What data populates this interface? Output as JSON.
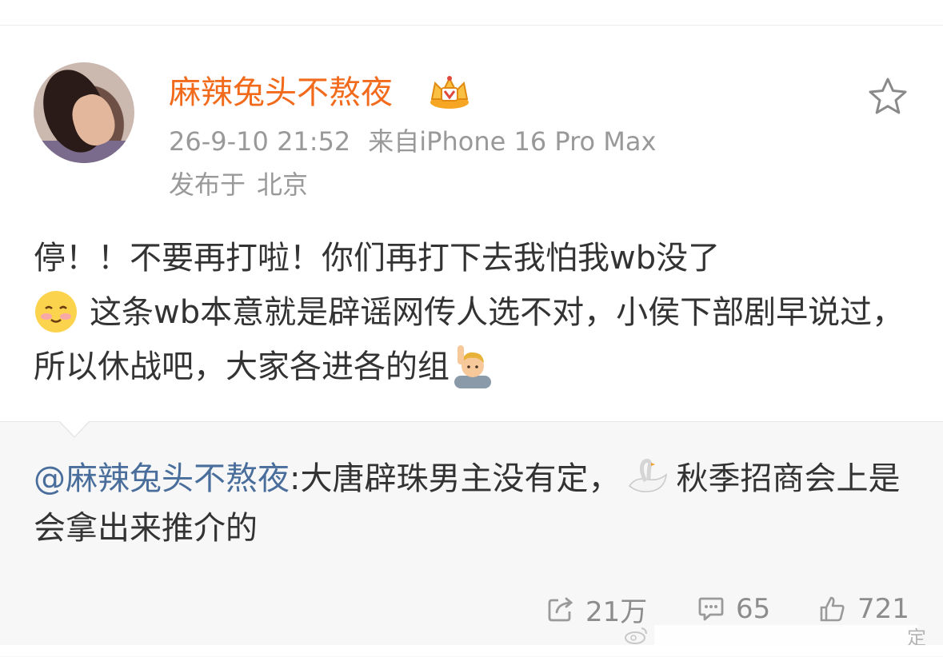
{
  "post": {
    "author": {
      "name": "麻辣兔头不熬夜",
      "badge_icon": "crown-vip-icon",
      "name_color": "#f26b1d"
    },
    "timestamp": "26-9-10 21:52",
    "source": "来自iPhone 16 Pro Max",
    "location_prefix": "发布于",
    "location": "北京",
    "body_part1": "停！！不要再打啦！你们再打下去我怕我wb没了",
    "body_part2": "这条wb本意就是辟谣网传人选不对，小侯下部剧早说过，所以休战吧，大家各进各的组",
    "favorite_icon": "star-outline-icon"
  },
  "repost": {
    "mention": "@麻辣兔头不熬夜",
    "text_part1": ":大唐辟珠男主没有定，",
    "text_part2": "秋季招商会上是会拿出来推介的",
    "mention_color": "#4a6e9c",
    "background": "#f7f7f7",
    "actions": {
      "repost_count": "21万",
      "comment_count": "65",
      "like_count": "721"
    }
  },
  "watermark": {
    "text": "定"
  },
  "footer_peek": "..."
}
